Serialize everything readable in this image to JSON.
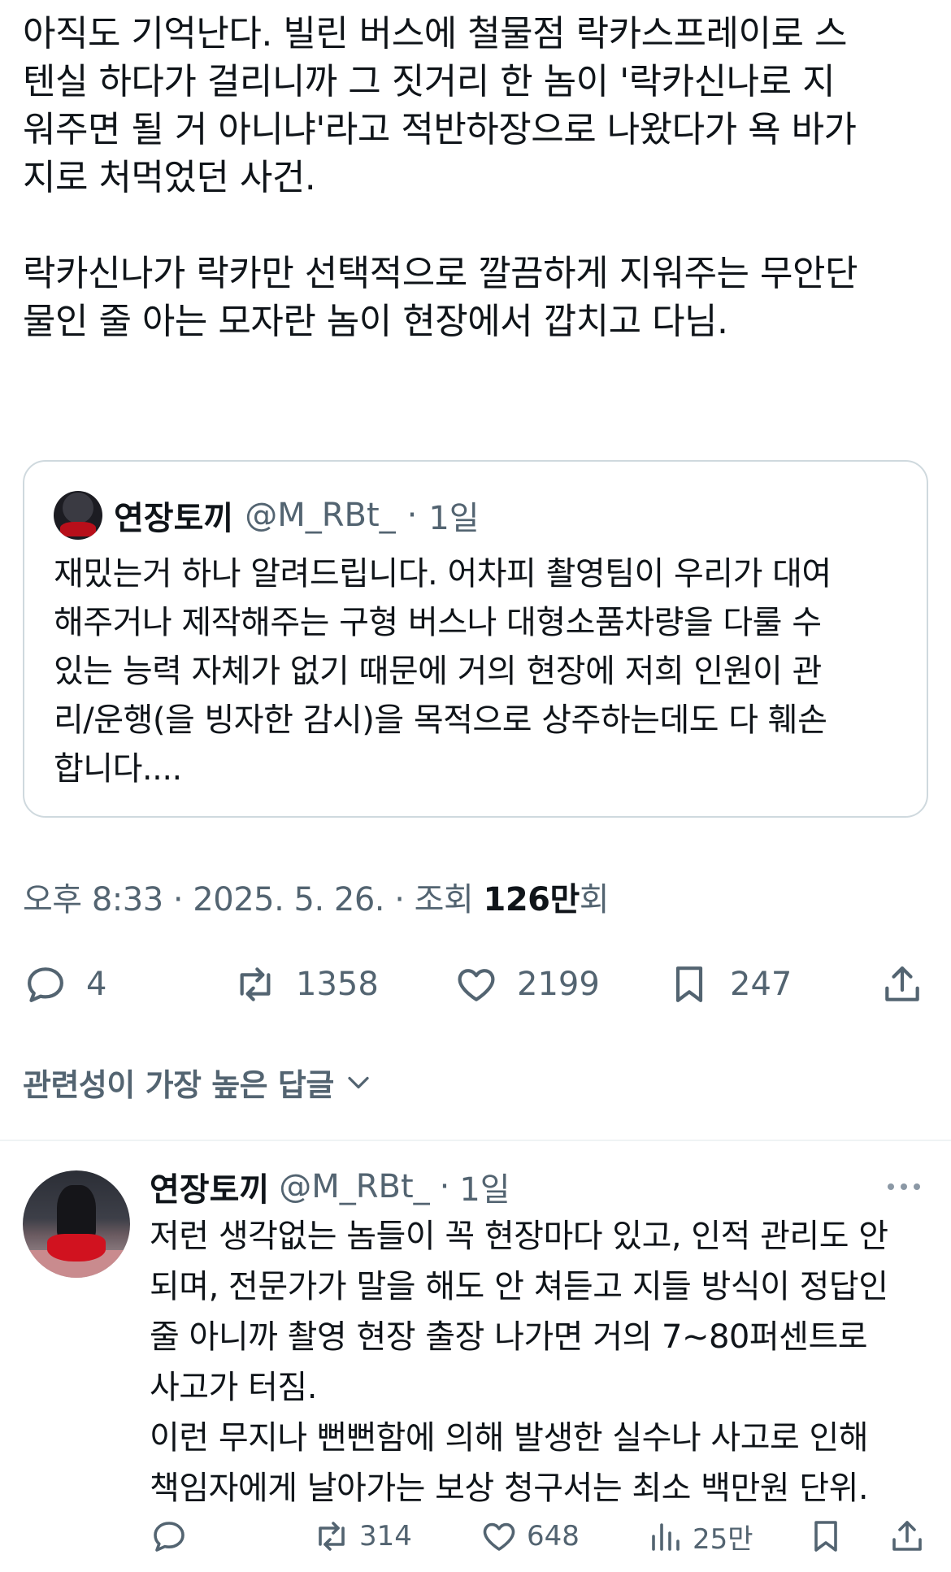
{
  "post": {
    "text": "아직도 기억난다. 빌린 버스에 철물점 락카스프레이로 스\n텐실 하다가 걸리니까 그 짓거리 한 놈이 '락카신나로 지\n워주면 될 거 아니냐'라고 적반하장으로 나왔다가 욕 바가\n지로 처먹었던 사건.\n\n락카신나가 락카만 선택적으로 깔끔하게 지워주는 무안단\n물인 줄 아는 모자란 놈이 현장에서 깝치고 다님."
  },
  "quote": {
    "name": "연장토끼",
    "handle": "@M_RBt_",
    "dot": "·",
    "time": "1일",
    "text": "재밌는거 하나 알려드립니다. 어차피 촬영팀이 우리가 대여\n해주거나 제작해주는 구형 버스나 대형소품차량을 다룰 수\n있는 능력 자체가 없기 때문에 거의 현장에 저희 인원이 관\n리/운행(을 빙자한 감시)을 목적으로 상주하는데도 다 훼손\n합니다...."
  },
  "meta": {
    "time": "오후 8:33",
    "sep1": " · ",
    "date": "2025. 5. 26.",
    "sep2": " · ",
    "views_label": "조회 ",
    "views_value": "126만",
    "views_suffix": "회"
  },
  "actions": {
    "replies": "4",
    "reposts": "1358",
    "likes": "2199",
    "bookmarks": "247"
  },
  "sort": {
    "label": "관련성이 가장 높은 답글"
  },
  "reply": {
    "name": "연장토끼",
    "handle": "@M_RBt_",
    "dot": "·",
    "time": "1일",
    "text": "저런 생각없는 놈들이 꼭 현장마다 있고, 인적 관리도 안\n되며, 전문가가 말을 해도 안 쳐듣고 지들 방식이 정답인\n줄 아니까 촬영 현장 출장 나가면 거의 7~80퍼센트로\n사고가 터짐.\n이런 무지나 뻔뻔함에 의해 발생한 실수나 사고로 인해\n책임자에게 날아가는 보상 청구서는 최소 백만원 단위.",
    "reposts": "314",
    "likes": "648",
    "views": "25만"
  },
  "colors": {
    "text": "#0f1419",
    "secondary": "#536471",
    "border": "#cfd9de"
  }
}
